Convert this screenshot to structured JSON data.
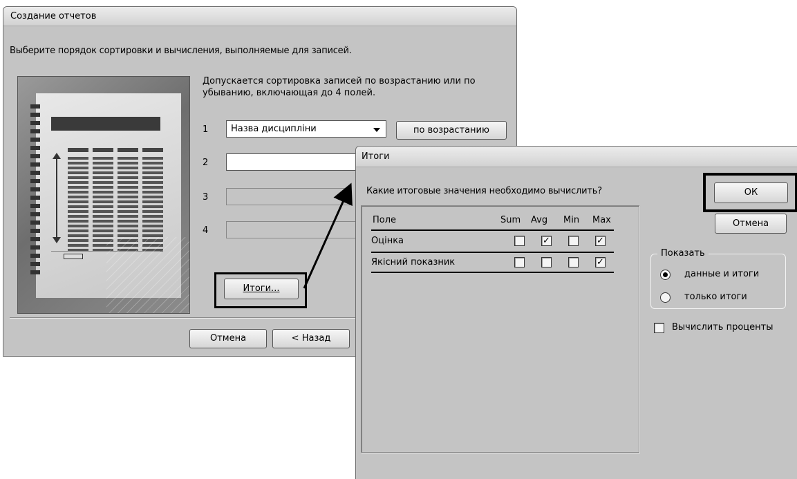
{
  "report_wizard": {
    "title": "Создание отчетов",
    "prompt": "Выберите порядок сортировки и вычисления, выполняемые для записей.",
    "description": "Допускается сортировка записей по возрастанию или по убыванию, включающая до 4 полей.",
    "sort_rows": [
      {
        "num": "1",
        "value": "Назва дисципліни",
        "order_label": "по возрастанию"
      },
      {
        "num": "2",
        "value": ""
      },
      {
        "num": "3",
        "value": ""
      },
      {
        "num": "4",
        "value": ""
      }
    ],
    "totals_button": "Итоги...",
    "cancel_button": "Отмена",
    "back_button": "< Назад"
  },
  "totals_dialog": {
    "title": "Итоги",
    "prompt": "Какие итоговые значения необходимо вычислить?",
    "columns": [
      "Поле",
      "Sum",
      "Avg",
      "Min",
      "Max"
    ],
    "rows": [
      {
        "label": "Оцінка",
        "sum": false,
        "avg": true,
        "min": false,
        "max": true
      },
      {
        "label": "Якісний показник",
        "sum": false,
        "avg": false,
        "min": false,
        "max": true
      }
    ],
    "ok_button": "ОК",
    "cancel_button": "Отмена",
    "show_group_label": "Показать",
    "show_options": [
      {
        "label": "данные и итоги",
        "selected": true
      },
      {
        "label": "только итоги",
        "selected": false
      }
    ],
    "percent_checkbox": {
      "label": "Вычислить проценты",
      "checked": false
    }
  },
  "colors": {
    "dialog_bg": "#c4c4c4",
    "highlight_frame": "#000000"
  }
}
